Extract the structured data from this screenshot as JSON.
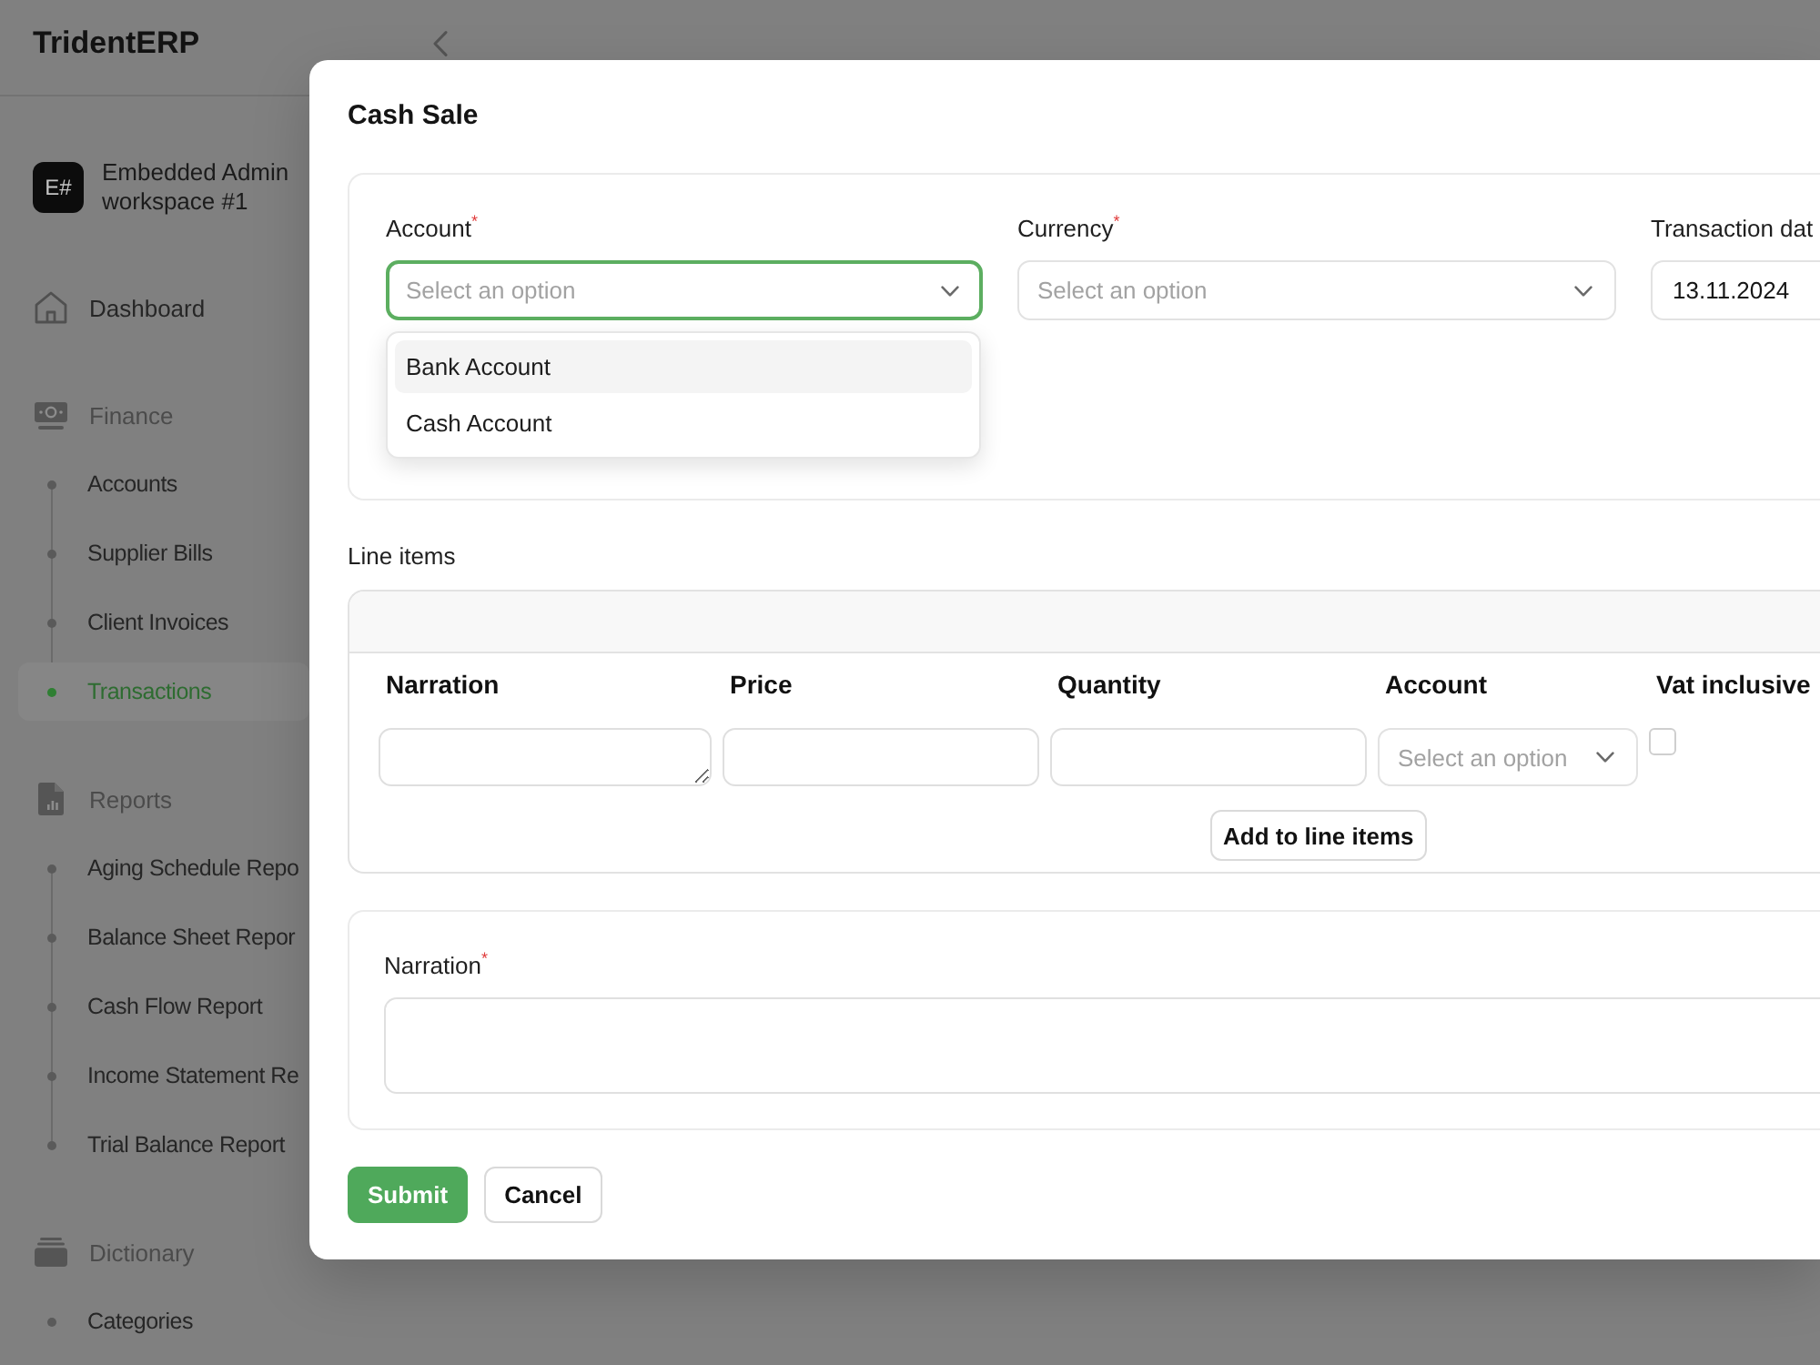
{
  "sidebar": {
    "brand": "TridentERP",
    "workspace": {
      "badge": "E#",
      "name": "Embedded Admin workspace #1"
    },
    "nav": [
      {
        "kind": "link",
        "label": "Dashboard",
        "selected": false
      },
      {
        "kind": "group",
        "label": "Finance",
        "children": [
          {
            "label": "Accounts",
            "selected": false
          },
          {
            "label": "Supplier Bills",
            "selected": false
          },
          {
            "label": "Client Invoices",
            "selected": false
          },
          {
            "label": "Transactions",
            "selected": true
          }
        ]
      },
      {
        "kind": "group",
        "label": "Reports",
        "children": [
          {
            "label": "Aging Schedule Repo",
            "selected": false
          },
          {
            "label": "Balance Sheet Repor",
            "selected": false
          },
          {
            "label": "Cash Flow Report",
            "selected": false
          },
          {
            "label": "Income Statement Re",
            "selected": false
          },
          {
            "label": "Trial Balance Report",
            "selected": false
          }
        ]
      },
      {
        "kind": "group",
        "label": "Dictionary",
        "children": [
          {
            "label": "Categories",
            "selected": false
          }
        ]
      }
    ]
  },
  "modal": {
    "title": "Cash Sale",
    "fields": [
      {
        "kind": "select",
        "label": "Account$^{*}$",
        "placeholder": "Select an option",
        "expanded": true,
        "options": [
          {
            "label": "Bank Account",
            "highlighted": true
          },
          {
            "label": "Cash Account",
            "highlighted": false
          }
        ]
      },
      {
        "kind": "select",
        "label": "Currency$^{*}$",
        "placeholder": "Select an option",
        "expanded": false
      },
      {
        "kind": "date",
        "label": "Transaction dat",
        "value": "13.11.2024"
      }
    ],
    "line_items": {
      "title": "Line items",
      "columns": [
        "Narration",
        "Price",
        "Quantity",
        "Account",
        "Vat inclusive"
      ],
      "inputs": [
        {
          "kind": "textarea"
        },
        {
          "kind": "text"
        },
        {
          "kind": "text"
        },
        {
          "kind": "select",
          "placeholder": "Select an option"
        },
        {
          "kind": "checkbox",
          "checked": false
        }
      ],
      "add_button": "Add to line items"
    },
    "narration": {
      "label": "Narration$^{*}$"
    },
    "buttons": [
      {
        "kind": "primary",
        "label": "Submit"
      },
      {
        "kind": "secondary",
        "label": "Cancel"
      }
    ]
  }
}
